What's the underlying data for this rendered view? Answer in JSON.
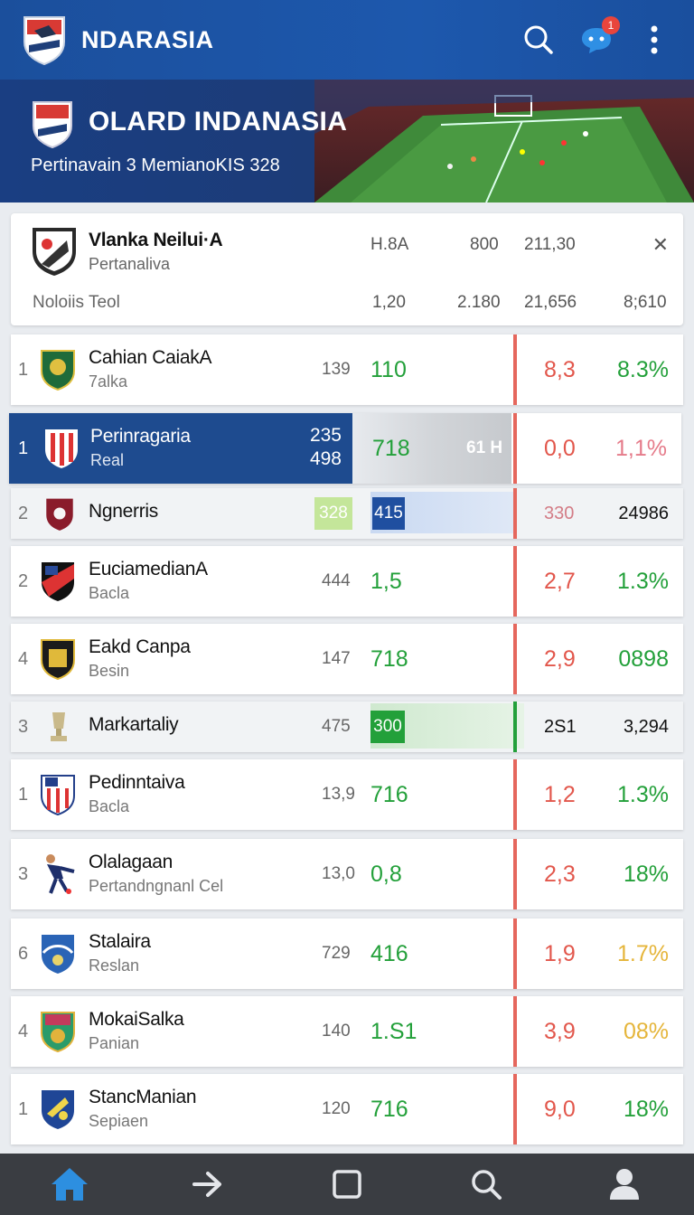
{
  "app": {
    "title": "NDARASIA",
    "notification_count": "1"
  },
  "hero": {
    "title": "OLARD INDANASIA",
    "subtitle": "Pertinavain 3 MemianoKIS 328"
  },
  "summary": {
    "team_name": "Vlanka Neilui·A",
    "team_sub": "Pertanaliva",
    "row_label": "Noloiis Teol",
    "top_values": [
      "H.8A",
      "800",
      "211,30"
    ],
    "bottom_values": [
      "1,20",
      "2.180",
      "21,656",
      "8;610"
    ],
    "close_label": "✕"
  },
  "rows": [
    {
      "rank": "1",
      "name": "Cahian CaiakA",
      "sub": "7alka",
      "v1": "139",
      "v2": "110",
      "v3": "8,3",
      "v4": "8.3%"
    },
    {
      "rank": "1",
      "name": "Perinragaria",
      "sub": "Real",
      "v1a": "235",
      "v1b": "498",
      "v2": "718",
      "ghost": "61 H",
      "v3": "0,0",
      "v4": "1,1%"
    },
    {
      "rank": "2",
      "name": "Ngnerris",
      "chip1": "328",
      "chip2": "415",
      "v3": "330",
      "v4": "24986"
    },
    {
      "rank": "2",
      "name": "EuciamedianA",
      "sub": "Bacla",
      "v1": "444",
      "v2": "1,5",
      "v3": "2,7",
      "v4": "1.3%"
    },
    {
      "rank": "4",
      "name": "Eakd Canpa",
      "sub": "Besin",
      "v1": "147",
      "v2": "718",
      "v3": "2,9",
      "v4": "0898"
    },
    {
      "rank": "3",
      "name": "Markartaliy",
      "v1": "475",
      "chip": "300",
      "v3": "2S1",
      "v4": "3,294"
    },
    {
      "rank": "1",
      "name": "Pedinntaiva",
      "sub": "Bacla",
      "v1": "13,9",
      "v2": "716",
      "v3": "1,2",
      "v4": "1.3%"
    },
    {
      "rank": "3",
      "name": "Olalagaan",
      "sub": "Pertandngnanl Cel",
      "v1": "13,0",
      "v2": "0,8",
      "v3": "2,3",
      "v4": "18%"
    },
    {
      "rank": "6",
      "name": "Stalaira",
      "sub": "Reslan",
      "v1": "729",
      "v2": "416",
      "v3": "1,9",
      "v4": "1.7%"
    },
    {
      "rank": "4",
      "name": "MokaiSalka",
      "sub": "Panian",
      "v1": "140",
      "v2": "1.S1",
      "v3": "3,9",
      "v4": "08%"
    },
    {
      "rank": "1",
      "name": "StancManian",
      "sub": "Sepiaen",
      "v1": "120",
      "v2": "716",
      "v3": "9,0",
      "v4": "18%"
    }
  ],
  "colors": {
    "brand": "#1d58ad",
    "positive": "#23a03a",
    "negative": "#e2574c",
    "warning": "#e5b53a",
    "nav_active": "#2d8fe0"
  },
  "icons": [
    "search-icon",
    "chat-icon",
    "more-vert-icon",
    "home-icon",
    "arrow-right-icon",
    "square-icon",
    "search-icon",
    "profile-icon"
  ]
}
